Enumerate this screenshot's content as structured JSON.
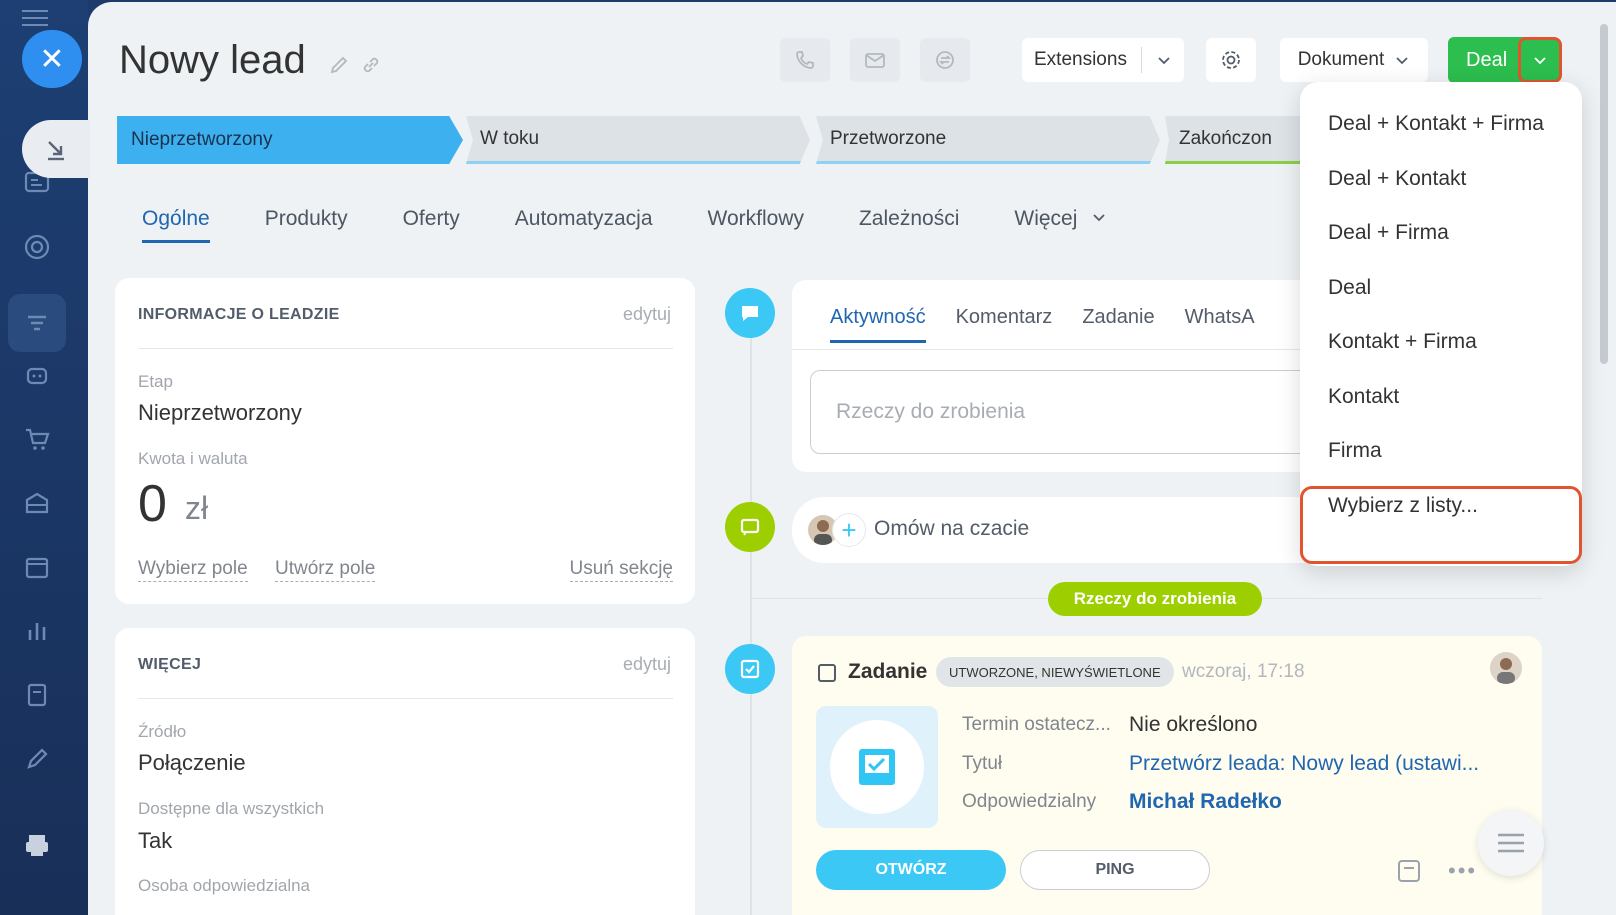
{
  "header": {
    "title": "Nowy lead",
    "extensions_label": "Extensions",
    "document_label": "Dokument",
    "deal_label": "Deal"
  },
  "stages": [
    {
      "label": "Nieprzetworzony"
    },
    {
      "label": "W toku"
    },
    {
      "label": "Przetworzone"
    },
    {
      "label": "Zakończon"
    }
  ],
  "tabs": [
    "Ogólne",
    "Produkty",
    "Oferty",
    "Automatyzacja",
    "Workflowy",
    "Zależności",
    "Więcej"
  ],
  "lead_info": {
    "heading": "INFORMACJE O LEADZIE",
    "edit": "edytuj",
    "stage_label": "Etap",
    "stage_value": "Nieprzetworzony",
    "amount_label": "Kwota i waluta",
    "amount_value": "0",
    "currency": "zł",
    "choose_field": "Wybierz pole",
    "create_field": "Utwórz pole",
    "remove_section": "Usuń sekcję"
  },
  "more_info": {
    "heading": "WIĘCEJ",
    "edit": "edytuj",
    "source_label": "Źródło",
    "source_value": "Połączenie",
    "available_label": "Dostępne dla wszystkich",
    "available_value": "Tak",
    "responsible_label": "Osoba odpowiedzialna"
  },
  "activity": {
    "tabs": [
      "Aktywność",
      "Komentarz",
      "Zadanie",
      "WhatsA"
    ],
    "todo_placeholder": "Rzeczy do zrobienia",
    "chat_label": "Omów na czacie",
    "todo_pill": "Rzeczy do zrobienia"
  },
  "task": {
    "title": "Zadanie",
    "badge": "UTWORZONE, NIEWYŚWIETLONE",
    "time": "wczoraj, 17:18",
    "deadline_label": "Termin ostatecz...",
    "deadline_value": "Nie określono",
    "subject_label": "Tytuł",
    "subject_value": "Przetwórz leada: Nowy lead (ustawi...",
    "responsible_label": "Odpowiedzialny",
    "responsible_value": "Michał Radełko",
    "open_button": "OTWÓRZ",
    "ping_button": "PING"
  },
  "deal_menu": [
    "Deal + Kontakt + Firma",
    "Deal + Kontakt",
    "Deal + Firma",
    "Deal",
    "Kontakt + Firma",
    "Kontakt",
    "Firma",
    "Wybierz z listy..."
  ],
  "colors": {
    "accent_blue": "#2066b0",
    "stage_active": "#3db0f0",
    "deal_green": "#2cbe4e",
    "highlight_red": "#e0552f",
    "todo_green": "#9dcf00"
  }
}
